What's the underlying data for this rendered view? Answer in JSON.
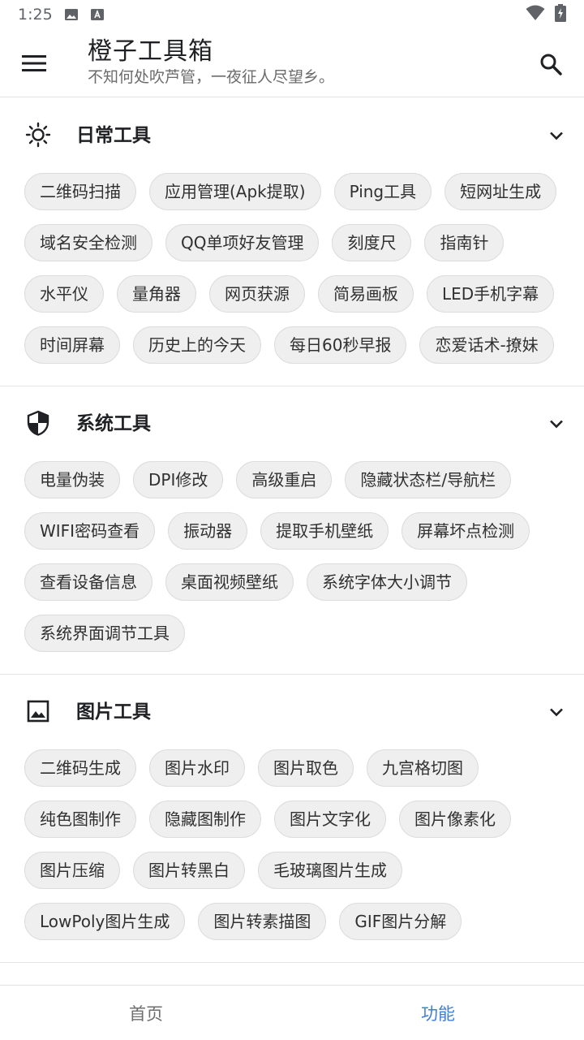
{
  "status_bar": {
    "time": "1:25",
    "icons": [
      "image-notification-icon",
      "a-notification-icon",
      "wifi-icon",
      "battery-charging-icon"
    ]
  },
  "app_bar": {
    "title": "橙子工具箱",
    "subtitle": "不知何处吹芦管，一夜征人尽望乡。",
    "menu_icon": "hamburger-menu-icon",
    "search_icon": "search-icon"
  },
  "sections": [
    {
      "title": "日常工具",
      "icon": "sun-icon",
      "chips": [
        "二维码扫描",
        "应用管理(Apk提取)",
        "Ping工具",
        "短网址生成",
        "域名安全检测",
        "QQ单项好友管理",
        "刻度尺",
        "指南针",
        "水平仪",
        "量角器",
        "网页获源",
        "简易画板",
        "LED手机字幕",
        "时间屏幕",
        "历史上的今天",
        "每日60秒早报",
        "恋爱话术-撩妹"
      ]
    },
    {
      "title": "系统工具",
      "icon": "shield-icon",
      "chips": [
        "电量伪装",
        "DPI修改",
        "高级重启",
        "隐藏状态栏/导航栏",
        "WIFI密码查看",
        "振动器",
        "提取手机壁纸",
        "屏幕坏点检测",
        "查看设备信息",
        "桌面视频壁纸",
        "系统字体大小调节",
        "系统界面调节工具"
      ]
    },
    {
      "title": "图片工具",
      "icon": "image-icon",
      "chips": [
        "二维码生成",
        "图片水印",
        "图片取色",
        "九宫格切图",
        "纯色图制作",
        "隐藏图制作",
        "图片文字化",
        "图片像素化",
        "图片压缩",
        "图片转黑白",
        "毛玻璃图片生成",
        "LowPoly图片生成",
        "图片转素描图",
        "GIF图片分解"
      ]
    }
  ],
  "bottom_nav": {
    "tabs": [
      {
        "label": "首页",
        "active": false
      },
      {
        "label": "功能",
        "active": true
      }
    ],
    "active_color": "#3f7fd6"
  }
}
